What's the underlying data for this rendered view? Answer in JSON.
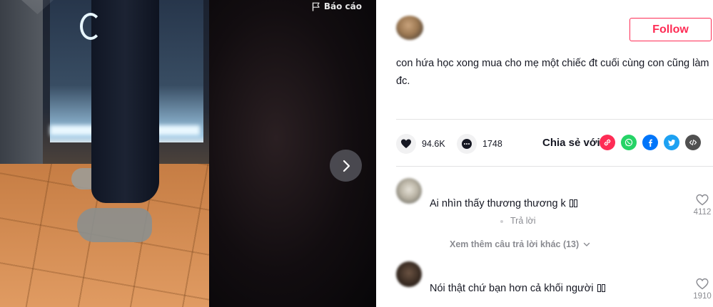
{
  "video": {
    "report_label": "Báo cáo"
  },
  "author": {
    "follow_label": "Follow",
    "caption": "con hứa học xong mua cho mẹ một chiếc đt cuối cùng con cũng làm đc."
  },
  "actions": {
    "likes": "94.6K",
    "comments": "1748",
    "share_label": "Chia sẻ với",
    "share_targets": [
      "embed-link",
      "whatsapp",
      "facebook",
      "twitter",
      "embed-code"
    ],
    "colors": {
      "link": "#fe2c55",
      "whatsapp": "#25d366",
      "facebook": "#0075fa",
      "twitter": "#1da1f2",
      "embed": "#505050"
    }
  },
  "comments": [
    {
      "text": "Ai nhìn thấy thương thương k",
      "likes": "4112",
      "reply_label": "Trả lời",
      "more_replies": "Xem thêm câu trả lời khác (13)"
    },
    {
      "text": "Nói thật chứ bạn hơn cả khối người",
      "likes": "1910"
    }
  ]
}
